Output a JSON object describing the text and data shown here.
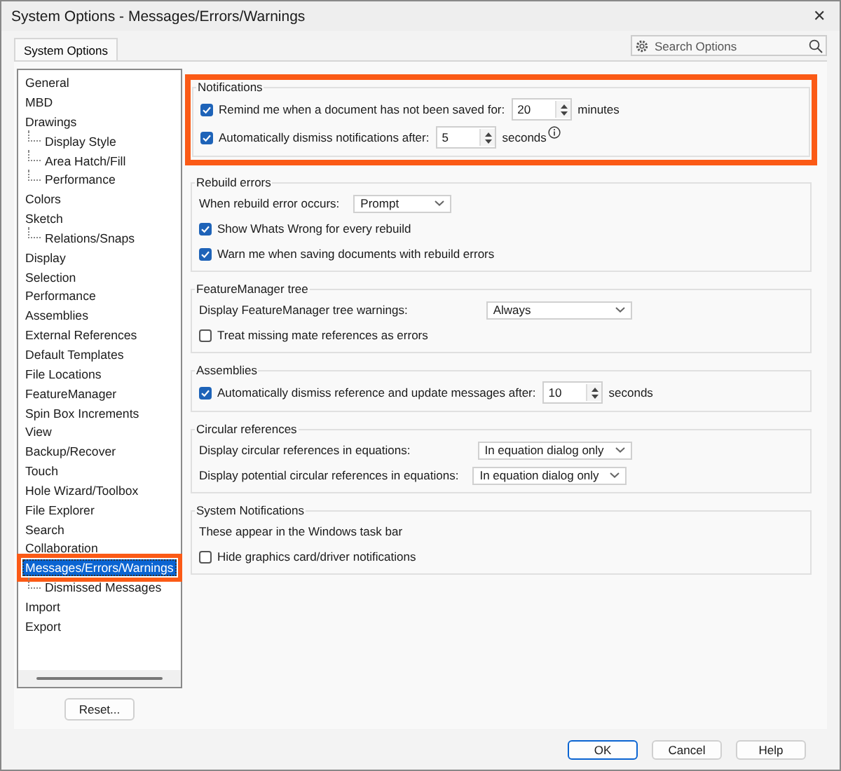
{
  "window": {
    "title": "System Options - Messages/Errors/Warnings",
    "close": "✕"
  },
  "tabs": [
    {
      "label": "System Options",
      "selected": true
    }
  ],
  "search": {
    "placeholder": "Search Options"
  },
  "tree": [
    {
      "label": "General",
      "selected": false
    },
    {
      "label": "MBD",
      "selected": false
    },
    {
      "label": "Drawings",
      "selected": false,
      "children": [
        {
          "label": "Display Style",
          "selected": false
        },
        {
          "label": "Area Hatch/Fill",
          "selected": false
        },
        {
          "label": "Performance",
          "selected": false
        }
      ]
    },
    {
      "label": "Colors",
      "selected": false
    },
    {
      "label": "Sketch",
      "selected": false,
      "children": [
        {
          "label": "Relations/Snaps",
          "selected": false
        }
      ]
    },
    {
      "label": "Display",
      "selected": false
    },
    {
      "label": "Selection",
      "selected": false
    },
    {
      "label": "Performance",
      "selected": false
    },
    {
      "label": "Assemblies",
      "selected": false
    },
    {
      "label": "External References",
      "selected": false
    },
    {
      "label": "Default Templates",
      "selected": false
    },
    {
      "label": "File Locations",
      "selected": false
    },
    {
      "label": "FeatureManager",
      "selected": false
    },
    {
      "label": "Spin Box Increments",
      "selected": false
    },
    {
      "label": "View",
      "selected": false
    },
    {
      "label": "Backup/Recover",
      "selected": false
    },
    {
      "label": "Touch",
      "selected": false
    },
    {
      "label": "Hole Wizard/Toolbox",
      "selected": false
    },
    {
      "label": "File Explorer",
      "selected": false
    },
    {
      "label": "Search",
      "selected": false
    },
    {
      "label": "Collaboration",
      "selected": false
    },
    {
      "label": "Messages/Errors/Warnings",
      "selected": true,
      "highlighted": true,
      "children": [
        {
          "label": "Dismissed Messages",
          "selected": false
        }
      ]
    },
    {
      "label": "Import",
      "selected": false
    },
    {
      "label": "Export",
      "selected": false
    }
  ],
  "reset_button": "Reset...",
  "groups": [
    {
      "title": "Notifications",
      "highlighted": true,
      "rows": [
        {
          "kind": "spin",
          "checked": true,
          "label": "Remind me when a document has not been saved for:",
          "value": "20",
          "unit": "minutes",
          "info": false
        },
        {
          "kind": "spin",
          "checked": true,
          "label": "Automatically dismiss notifications after:",
          "value": "5",
          "unit": "seconds",
          "info": true
        }
      ]
    },
    {
      "title": "Rebuild errors",
      "highlighted": false,
      "rows": [
        {
          "kind": "select",
          "label": "When rebuild error occurs:",
          "value": "Prompt"
        },
        {
          "kind": "check",
          "checked": true,
          "label": "Show Whats Wrong for every rebuild"
        },
        {
          "kind": "check",
          "checked": true,
          "label": "Warn me when saving documents with rebuild errors"
        }
      ]
    },
    {
      "title": "FeatureManager tree",
      "highlighted": false,
      "rows": [
        {
          "kind": "select",
          "label": "Display FeatureManager tree warnings:",
          "value": "Always"
        },
        {
          "kind": "check",
          "checked": false,
          "label": "Treat missing mate references as errors"
        }
      ]
    },
    {
      "title": "Assemblies",
      "highlighted": false,
      "rows": [
        {
          "kind": "spin",
          "checked": true,
          "label": "Automatically dismiss reference and update messages after:",
          "value": "10",
          "unit": "seconds",
          "info": false
        }
      ]
    },
    {
      "title": "Circular references",
      "highlighted": false,
      "rows": [
        {
          "kind": "select",
          "label": "Display circular references in equations:",
          "value": "In equation dialog only"
        },
        {
          "kind": "select",
          "label": "Display potential circular references in equations:",
          "value": "In equation dialog only"
        }
      ]
    },
    {
      "title": "System Notifications",
      "highlighted": false,
      "rows": [
        {
          "kind": "text",
          "label": "These appear in the Windows task bar"
        },
        {
          "kind": "check",
          "checked": false,
          "label": "Hide graphics card/driver notifications"
        }
      ]
    }
  ],
  "buttons": [
    "OK",
    "Cancel",
    "Help"
  ]
}
